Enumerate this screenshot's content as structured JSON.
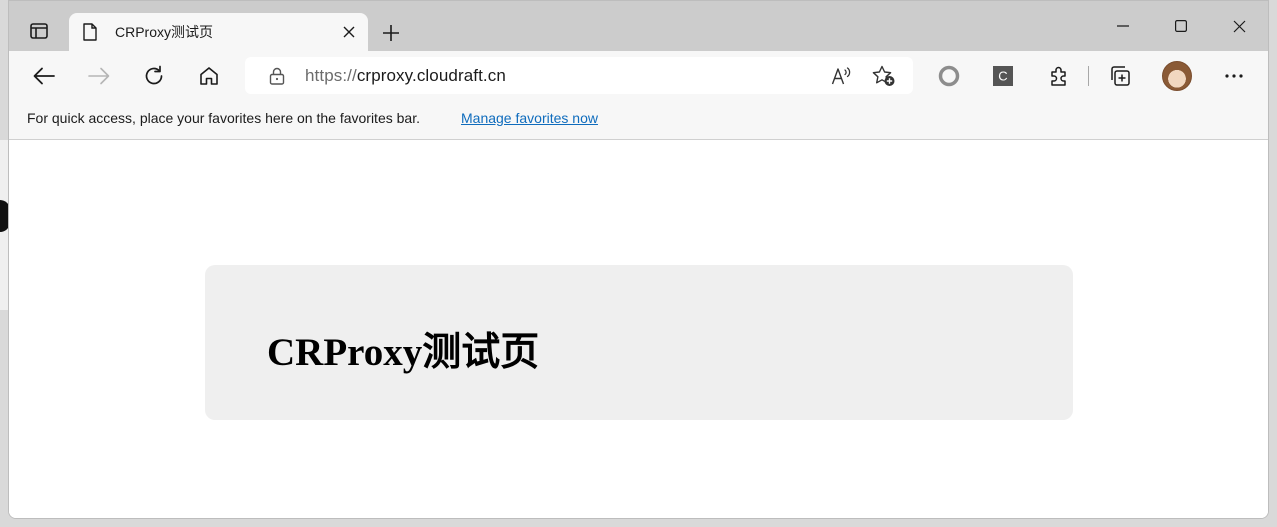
{
  "tab": {
    "title": "CRProxy测试页",
    "icons": {
      "actions": "tab-actions-icon",
      "favicon": "page-icon",
      "close": "close-icon"
    }
  },
  "new_tab_icon": "plus-icon",
  "window_controls": [
    "minimize-icon",
    "maximize-icon",
    "close-icon"
  ],
  "toolbar": {
    "back": "back-arrow-icon",
    "forward": "forward-arrow-icon",
    "refresh": "refresh-icon",
    "home": "home-icon",
    "address": {
      "scheme": "https://",
      "host": "crproxy.cloudraft.cn",
      "lock": "lock-icon",
      "read_aloud": "read-aloud-icon",
      "add_favorite": "add-favorite-icon"
    },
    "extensions": [
      "circle-extension-icon",
      "c-extension-icon",
      "puzzle-icon"
    ],
    "collections": "collections-icon",
    "profile": "avatar",
    "menu": "more-icon"
  },
  "favorites_bar": {
    "message": "For quick access, place your favorites here on the favorites bar.",
    "link": "Manage favorites now"
  },
  "page": {
    "heading": "CRProxy测试页"
  },
  "colors": {
    "tabstrip": "#cccccc",
    "toolbar": "#f7f7f7",
    "link": "#0f6cbd",
    "card": "#efefef"
  }
}
